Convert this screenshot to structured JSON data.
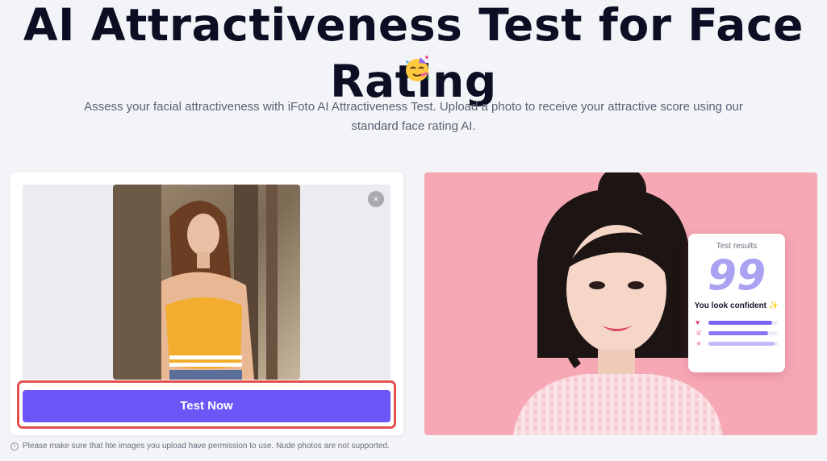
{
  "hero": {
    "title": "AI Attractiveness Test for Face Rating",
    "subtitle": "Assess your facial attractiveness with iFoto AI Attractiveness Test. Upload a photo to receive your attractive score using our standard face rating AI.",
    "emoji_icon": "partying-face-emoji"
  },
  "upload": {
    "close_label": "×",
    "button_label": "Test Now",
    "notice_icon": "info-icon",
    "notice": "Please make sure that hte images you upload have permission to use. Nude photos are not supported."
  },
  "sample": {
    "result_label": "Test results",
    "score": "99",
    "verdict": "You look confident ✨",
    "metrics": [
      {
        "icon": "heart-icon",
        "level": 0.92,
        "color": "#7b63f5",
        "icon_color": "#e8416a"
      },
      {
        "icon": "crown-icon",
        "level": 0.86,
        "color": "#8b75f6",
        "icon_color": "#f0a0c0"
      },
      {
        "icon": "star-icon",
        "level": 0.95,
        "color": "#c3b9f8",
        "icon_color": "#f2a0c0"
      }
    ]
  },
  "colors": {
    "accent": "#6b56f8",
    "highlight": "#e4504f",
    "panel_pink": "#f7a8b5"
  }
}
